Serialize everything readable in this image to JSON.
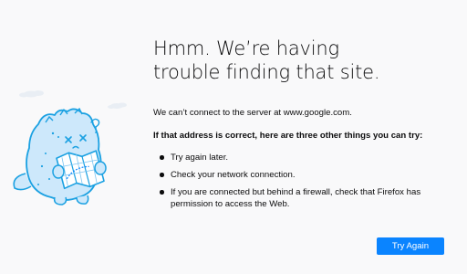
{
  "error": {
    "title": "Hmm. We’re having trouble finding that site.",
    "description": "We can’t connect to the server at www.google.com.",
    "subheading": "If that address is correct, here are three other things you can try:",
    "suggestions": [
      {
        "text": "Try again later."
      },
      {
        "text": "Check your network connection."
      },
      {
        "text": "If you are connected but behind a firewall, check that Firefox has permission to access the Web."
      }
    ]
  },
  "actions": {
    "try_again_label": "Try Again"
  },
  "illustration": {
    "icon": "confused-creature-with-map-icon",
    "accent_color": "#0a84ff",
    "line_color": "#1ba1e2",
    "fill_color": "#cde8fb"
  },
  "colors": {
    "background": "#f9f9fa",
    "text": "#0c0c0d",
    "button": "#0a84ff",
    "button_text": "#ffffff"
  }
}
